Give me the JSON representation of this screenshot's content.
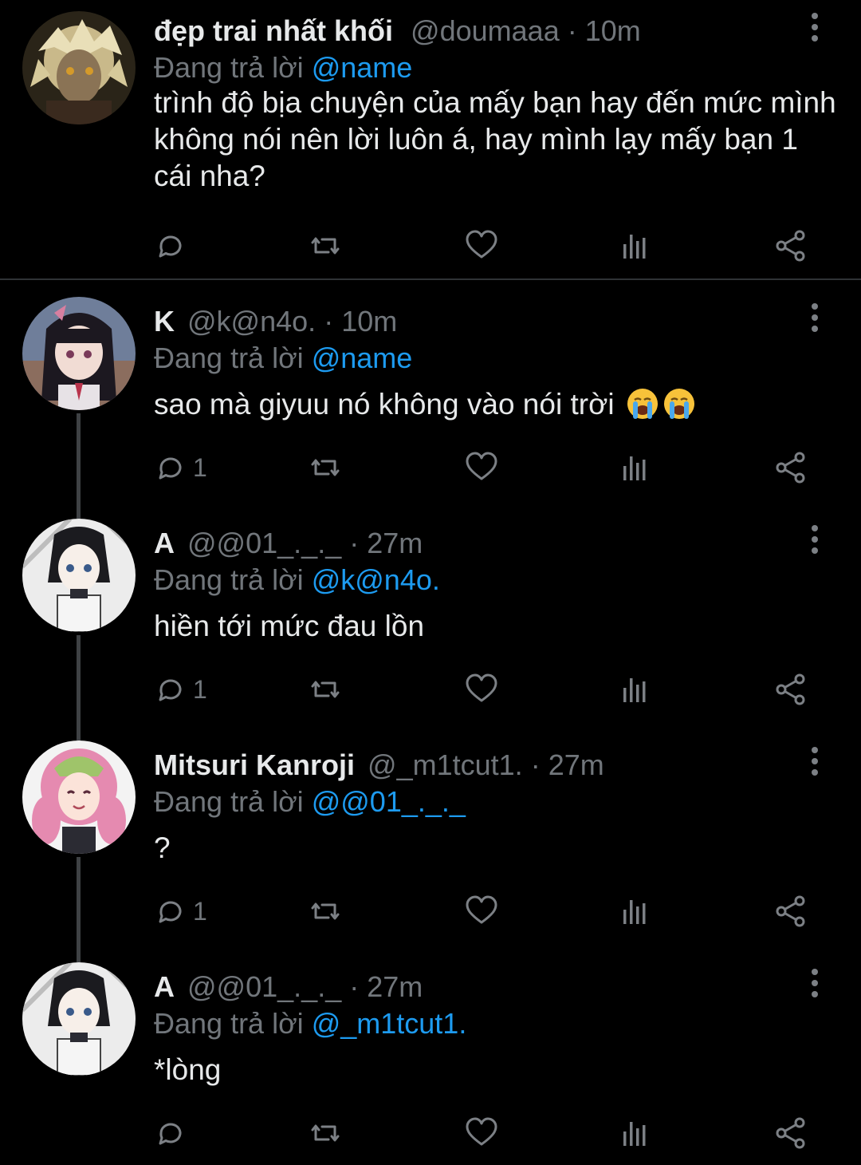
{
  "replying_prefix": "Đang trả lời",
  "tweets": [
    {
      "name": "đẹp trai nhất khối",
      "handle": "@doumaaa",
      "sep": "·",
      "time": "10m",
      "replying_to": "@name",
      "text": "trình độ bịa chuyện của mấy bạn hay đến mức mình không nói nên lời luôn á, hay mình lạy mấy bạn 1 cái nha?",
      "reply_count": ""
    },
    {
      "name": "K",
      "handle": "@k@n4o.",
      "sep": "·",
      "time": "10m",
      "replying_to": "@name",
      "text": "sao mà giyuu nó không vào nói trời",
      "emoji": [
        "loudly-crying-face",
        "loudly-crying-face"
      ],
      "reply_count": "1"
    },
    {
      "name": "A",
      "handle": "@@01_._._",
      "sep": "·",
      "time": "27m",
      "replying_to": "@k@n4o.",
      "text": "hiền tới mức đau lồn",
      "reply_count": "1"
    },
    {
      "name": "Mitsuri Kanroji",
      "handle": "@_m1tcut1.",
      "sep": "·",
      "time": "27m",
      "replying_to": "@@01_._._",
      "text": "?",
      "reply_count": "1"
    },
    {
      "name": "A",
      "handle": "@@01_._._",
      "sep": "·",
      "time": "27m",
      "replying_to": "@_m1tcut1.",
      "text": "*lòng",
      "reply_count": ""
    }
  ],
  "colors": {
    "background": "#000000",
    "text": "#e7e9ea",
    "muted": "#71767b",
    "mention": "#1d9bf0",
    "thread_line": "#3e4144"
  }
}
